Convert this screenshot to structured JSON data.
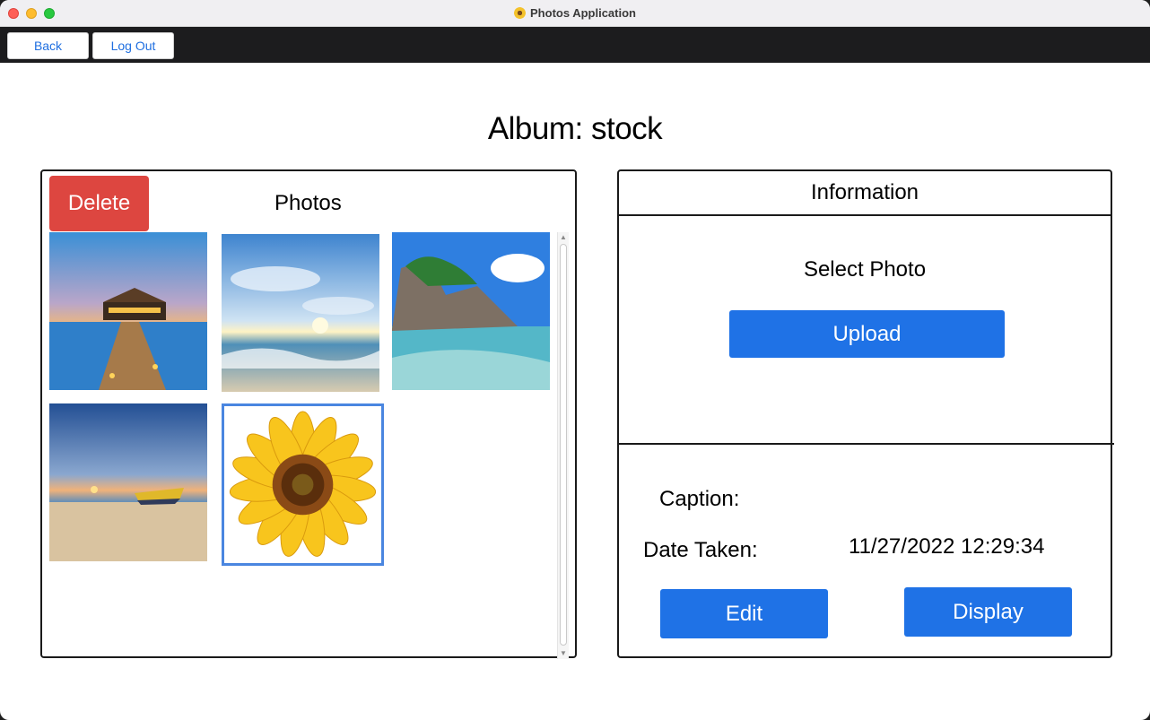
{
  "window": {
    "title": "Photos Application"
  },
  "toolbar": {
    "back_label": "Back",
    "logout_label": "Log Out"
  },
  "album": {
    "title": "Album: stock"
  },
  "photos_panel": {
    "delete_label": "Delete",
    "title": "Photos",
    "photos": [
      {
        "icon": "beach-pier-image"
      },
      {
        "icon": "ocean-sky-image"
      },
      {
        "icon": "tropical-rocks-image"
      },
      {
        "icon": "beach-boat-image"
      },
      {
        "icon": "sunflower-image",
        "selected": true
      }
    ]
  },
  "info_panel": {
    "header": "Information",
    "select_photo": "Select Photo",
    "upload_label": "Upload",
    "caption_label": "Caption:",
    "caption_value": "",
    "date_label": "Date Taken:",
    "date_value": "11/27/2022 12:29:34",
    "edit_label": "Edit",
    "display_label": "Display"
  },
  "colors": {
    "accent_blue": "#1f72e6",
    "delete_red": "#dd4640",
    "toolbar_bg": "#1c1c1e",
    "link_blue": "#1f6fe0",
    "selection_border": "#4a86e0"
  }
}
